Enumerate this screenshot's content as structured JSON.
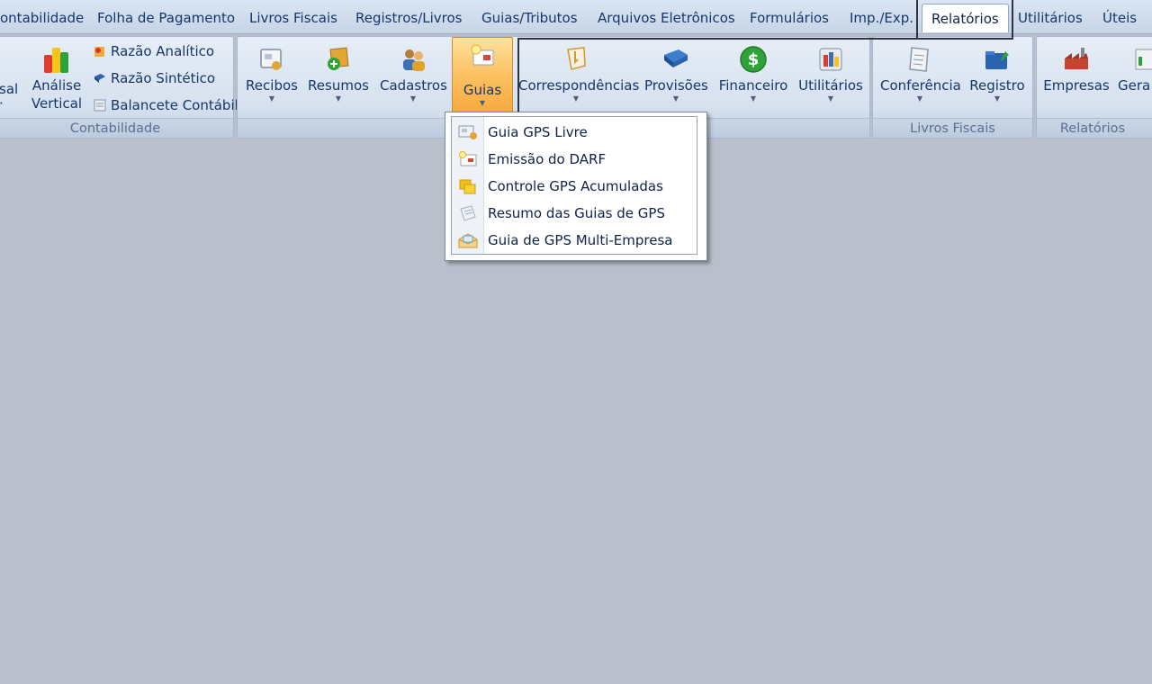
{
  "tabs": [
    {
      "label": "ontabilidade"
    },
    {
      "label": "Folha de Pagamento"
    },
    {
      "label": "Livros Fiscais"
    },
    {
      "label": "Registros/Livros"
    },
    {
      "label": "Guias/Tributos"
    },
    {
      "label": "Arquivos Eletrônicos"
    },
    {
      "label": "Formulários"
    },
    {
      "label": "Imp./Exp."
    },
    {
      "label": "Relatórios",
      "active": true
    },
    {
      "label": "Utilitários"
    },
    {
      "label": "Úteis"
    }
  ],
  "ribbon": {
    "contabilidade": {
      "label": "Contabilidade",
      "partial_button": {
        "line1": "sal",
        "line2": "·"
      },
      "analise": {
        "line1": "Análise",
        "line2": "Vertical",
        "icon": "bar-chart-icon"
      },
      "small": [
        {
          "label": "Razão Analítico",
          "icon": "ledger-analytic-icon"
        },
        {
          "label": "Razão Sintético",
          "icon": "ledger-synthetic-icon"
        },
        {
          "label": "Balancete Contábil",
          "icon": "balance-sheet-icon"
        }
      ]
    },
    "folha": {
      "buttons": [
        {
          "label": "Recibos",
          "icon": "receipt-icon"
        },
        {
          "label": "Resumos",
          "icon": "summary-add-icon"
        },
        {
          "label": "Cadastros",
          "icon": "people-icon"
        },
        {
          "label": "Guias",
          "icon": "guide-document-icon",
          "pressed": true
        },
        {
          "label": "Correspondências",
          "icon": "letter-icon"
        },
        {
          "label": "Provisões",
          "icon": "book-icon"
        },
        {
          "label": "Financeiro",
          "icon": "dollar-icon"
        },
        {
          "label": "Utilitários",
          "icon": "tools-icon"
        }
      ]
    },
    "livros": {
      "label": "Livros Fiscais",
      "buttons": [
        {
          "label": "Conferência",
          "icon": "checklist-icon"
        },
        {
          "label": "Registro",
          "icon": "register-folder-icon"
        }
      ]
    },
    "relatorios": {
      "label": "Relatórios",
      "buttons": [
        {
          "label": "Empresas",
          "icon": "factory-icon"
        },
        {
          "label": "Gera",
          "icon": "generate-report-icon"
        }
      ]
    }
  },
  "dropdown": {
    "items": [
      {
        "label": "Guia GPS Livre",
        "icon": "gps-free-icon"
      },
      {
        "label": "Emissão do DARF",
        "icon": "darf-icon"
      },
      {
        "label": "Controle GPS Acumuladas",
        "icon": "gps-accumulated-icon"
      },
      {
        "label": "Resumo das Guias de GPS",
        "icon": "gps-summary-icon"
      },
      {
        "label": "Guia de GPS Multi-Empresa",
        "icon": "gps-multi-company-icon"
      }
    ]
  },
  "colors": {
    "background": "#b9c0cc",
    "text": "#15366b",
    "pressed_orange": "#fcc365",
    "accent_green": "#2fa33a"
  }
}
